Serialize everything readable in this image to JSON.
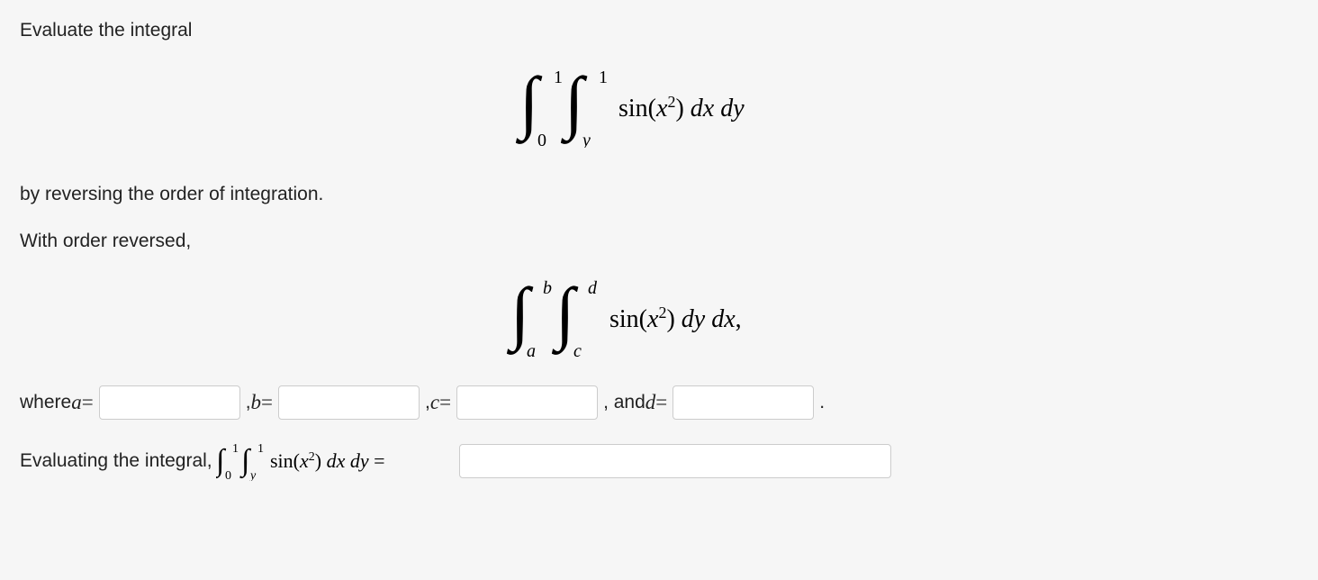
{
  "prompt": {
    "line1": "Evaluate the integral",
    "line2": "by reversing the order of integration.",
    "line3": "With order reversed,",
    "where": "where ",
    "a_label": "a",
    "b_label": "b",
    "c_label": "c",
    "d_label": "d",
    "and": ", and ",
    "equals": " =",
    "comma": ", ",
    "period": ".",
    "evaluating": "Evaluating the integral, "
  },
  "math": {
    "integral1": {
      "outer_lower": "0",
      "outer_upper": "1",
      "inner_lower": "y",
      "inner_upper": "1",
      "integrand": "sin(x²) dx dy"
    },
    "integral2": {
      "outer_lower": "a",
      "outer_upper": "b",
      "inner_lower": "c",
      "inner_upper": "d",
      "integrand": "sin(x²) dy dx,"
    },
    "inline_integral": {
      "outer_lower": "0",
      "outer_upper": "1",
      "inner_lower": "y",
      "inner_upper": "1",
      "integrand": "sin(x²) dx dy ="
    }
  },
  "inputs": {
    "a": "",
    "b": "",
    "c": "",
    "d": "",
    "result": ""
  }
}
